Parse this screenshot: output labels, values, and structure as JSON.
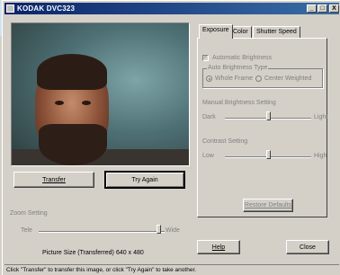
{
  "window": {
    "title": "KODAK DVC323",
    "controls": {
      "minimize": "_",
      "maximize": "□",
      "close": "X"
    }
  },
  "preview": {
    "transfer_label": "Transfer",
    "try_again_label": "Try Again"
  },
  "zoom": {
    "group_label": "Zoom Setting",
    "min_label": "Tele",
    "max_label": "Wide",
    "level": 0.95
  },
  "picture_size": {
    "label": "Picture Size (Transferred)",
    "value": "640 x 480"
  },
  "tabs": [
    {
      "label": "Exposure",
      "active": true
    },
    {
      "label": "Color",
      "active": false
    },
    {
      "label": "Shutter Speed",
      "active": false
    }
  ],
  "exposure": {
    "auto_brightness_label": "Automatic Brightness",
    "auto_brightness_checked": true,
    "brightness_type_label": "Auto Brightness Type",
    "whole_frame_label": "Whole Frame",
    "center_weighted_label": "Center Weighted",
    "selected_type": "Whole Frame",
    "manual_brightness_label": "Manual Brightness Setting",
    "manual_min": "Dark",
    "manual_max": "Light",
    "manual_level": 0.5,
    "contrast_label": "Contrast Setting",
    "contrast_min": "Low",
    "contrast_max": "High",
    "contrast_level": 0.5,
    "restore_label": "Restore Defaults"
  },
  "footer_buttons": {
    "help": "Help",
    "close": "Close"
  },
  "status": {
    "text": "Click \"Transfer\" to transfer this image, or click \"Try Again\" to take another."
  }
}
